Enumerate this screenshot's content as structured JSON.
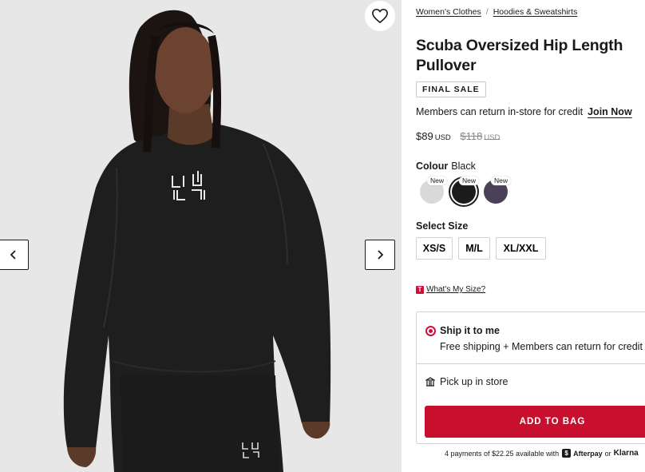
{
  "breadcrumb": {
    "item1": "Women's Clothes",
    "separator": "/",
    "item2": "Hoodies & Sweatshirts"
  },
  "product": {
    "title": "Scuba Oversized Hip Length Pullover",
    "badge": "FINAL SALE",
    "members_text": "Members can return in-store for credit",
    "join_link": "Join Now",
    "price": "$89",
    "price_currency": "USD",
    "original_price": "$118",
    "original_currency": "USD"
  },
  "colour": {
    "label": "Colour",
    "selected": "Black",
    "swatches": [
      {
        "badge": "New",
        "color": "#d9d9d9"
      },
      {
        "badge": "New",
        "color": "#1c1c1c"
      },
      {
        "badge": "New",
        "color": "#4a4058"
      }
    ]
  },
  "size": {
    "label": "Select Size",
    "options": [
      "XS/S",
      "M/L",
      "XL/XXL"
    ]
  },
  "size_guide": {
    "icon": "T",
    "link": "What's My Size?"
  },
  "shipping": {
    "ship_title": "Ship it to me",
    "ship_sub": "Free shipping + Members can return for credit",
    "pickup": "Pick up in store"
  },
  "cta": {
    "add_to_bag": "ADD TO BAG"
  },
  "payments": {
    "text": "4 payments of $22.25 available with",
    "afterpay_icon": "$",
    "afterpay": "Afterpay",
    "or": "or",
    "klarna": "Klarna"
  },
  "icons": {
    "wishlist": "heart-icon",
    "prev": "chevron-left-icon",
    "next": "chevron-right-icon",
    "store": "store-icon"
  },
  "colors": {
    "accent": "#c8102e",
    "radio": "#d0103a"
  }
}
